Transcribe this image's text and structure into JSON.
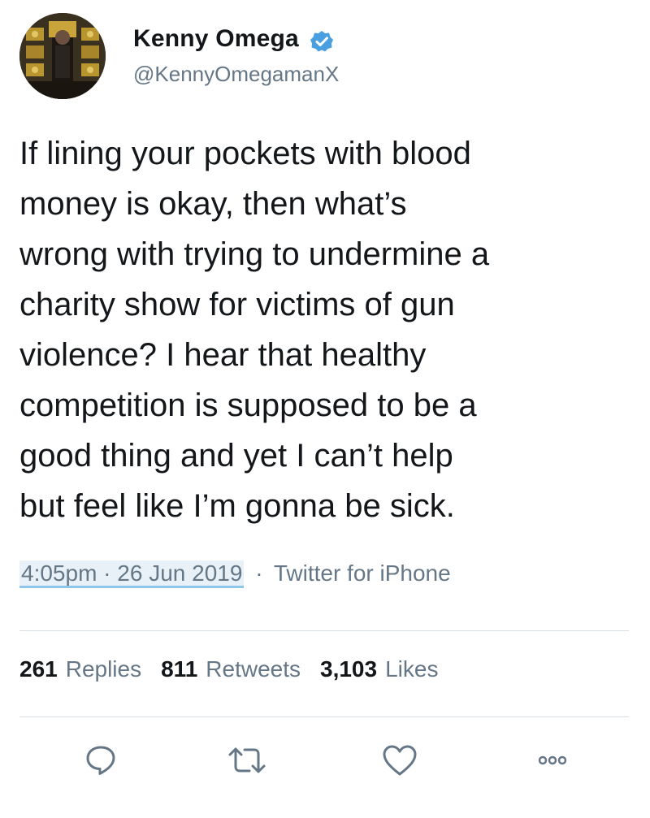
{
  "author": {
    "display_name": "Kenny Omega",
    "handle": "@KennyOmegamanX",
    "verified_icon": "verified-badge-icon"
  },
  "tweet": {
    "text": "If lining your pockets with blood\nmoney is okay, then what’s\nwrong with trying to undermine a\ncharity show for victims of gun\nviolence? I hear that healthy\ncompetition is supposed to be a\ngood thing and yet I can’t help\nbut feel like I’m gonna be sick.",
    "timestamp": "4:05pm · 26 Jun 2019",
    "separator": "·",
    "source": "Twitter for iPhone"
  },
  "stats": {
    "replies_count": "261",
    "replies_label": "Replies",
    "retweets_count": "811",
    "retweets_label": "Retweets",
    "likes_count": "3,103",
    "likes_label": "Likes"
  },
  "actions": {
    "reply_icon": "reply-icon",
    "retweet_icon": "retweet-icon",
    "like_icon": "heart-icon",
    "more_icon": "more-options-icon"
  },
  "colors": {
    "text_primary": "#14171a",
    "text_secondary": "#657786",
    "verified_blue": "#4a9fe0",
    "divider": "#d6dde3",
    "timestamp_underline": "#8ec5ea"
  }
}
